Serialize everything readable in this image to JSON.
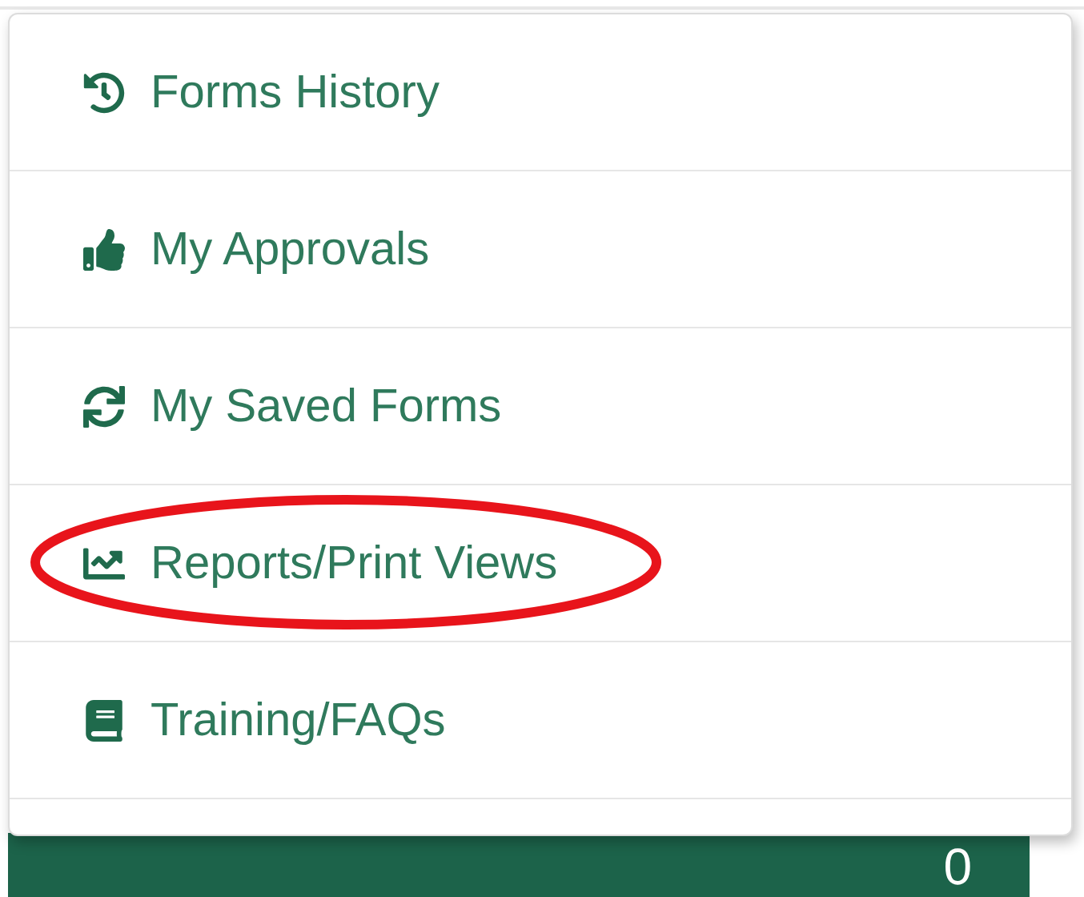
{
  "menu": {
    "items": [
      {
        "label": "Forms History",
        "kind": "history",
        "circled": false
      },
      {
        "label": "My Approvals",
        "kind": "approvals",
        "circled": false
      },
      {
        "label": "My Saved Forms",
        "kind": "saved",
        "circled": false
      },
      {
        "label": "Reports/Print Views",
        "kind": "reports",
        "circled": true
      },
      {
        "label": "Training/FAQs",
        "kind": "training",
        "circled": false
      }
    ]
  },
  "counter_bar": {
    "value": "0"
  }
}
